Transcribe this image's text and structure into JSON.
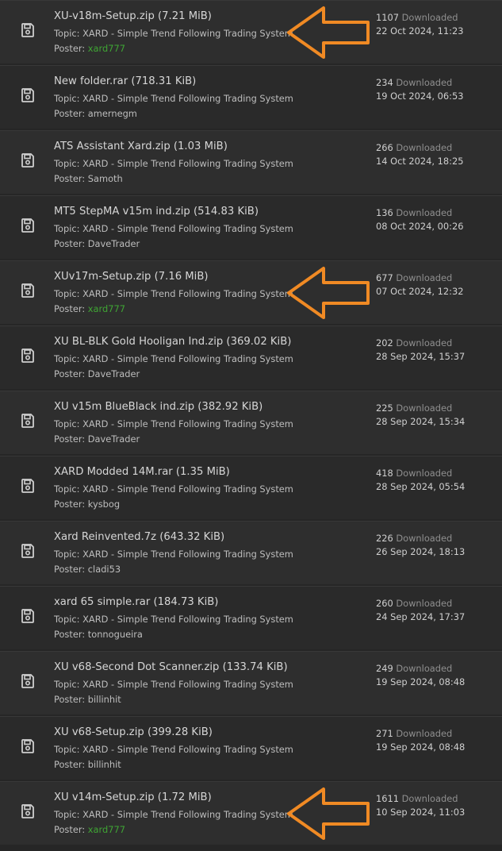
{
  "colors": {
    "background": "#262626",
    "row_background": "#2d2d2d",
    "text": "#d6d6d6",
    "muted": "#8f8f8f",
    "poster_highlight": "#3fa534",
    "annotation_arrow": "#f08a24"
  },
  "labels": {
    "topic_prefix": "Topic: ",
    "poster_prefix": "Poster: ",
    "downloaded": "Downloaded"
  },
  "attachments": [
    {
      "title": "XU-v18m-Setup.zip (7.21 MiB)",
      "topic": "XARD - Simple Trend Following Trading System",
      "poster": "xard777",
      "poster_highlight": true,
      "downloads": "1107",
      "date": "22 Oct 2024, 11:23",
      "arrow": true
    },
    {
      "title": "New folder.rar (718.31 KiB)",
      "topic": "XARD - Simple Trend Following Trading System",
      "poster": "amernegm",
      "poster_highlight": false,
      "downloads": "234",
      "date": "19 Oct 2024, 06:53",
      "arrow": false
    },
    {
      "title": "ATS Assistant Xard.zip (1.03 MiB)",
      "topic": "XARD - Simple Trend Following Trading System",
      "poster": "Samoth",
      "poster_highlight": false,
      "downloads": "266",
      "date": "14 Oct 2024, 18:25",
      "arrow": false
    },
    {
      "title": "MT5 StepMA v15m ind.zip (514.83 KiB)",
      "topic": "XARD - Simple Trend Following Trading System",
      "poster": "DaveTrader",
      "poster_highlight": false,
      "downloads": "136",
      "date": "08 Oct 2024, 00:26",
      "arrow": false
    },
    {
      "title": "XUv17m-Setup.zip (7.16 MiB)",
      "topic": "XARD - Simple Trend Following Trading System",
      "poster": "xard777",
      "poster_highlight": true,
      "downloads": "677",
      "date": "07 Oct 2024, 12:32",
      "arrow": true
    },
    {
      "title": "XU BL-BLK Gold Hooligan Ind.zip (369.02 KiB)",
      "topic": "XARD - Simple Trend Following Trading System",
      "poster": "DaveTrader",
      "poster_highlight": false,
      "downloads": "202",
      "date": "28 Sep 2024, 15:37",
      "arrow": false
    },
    {
      "title": "XU v15m BlueBlack ind.zip (382.92 KiB)",
      "topic": "XARD - Simple Trend Following Trading System",
      "poster": "DaveTrader",
      "poster_highlight": false,
      "downloads": "225",
      "date": "28 Sep 2024, 15:34",
      "arrow": false
    },
    {
      "title": "XARD Modded 14M.rar (1.35 MiB)",
      "topic": "XARD - Simple Trend Following Trading System",
      "poster": "kysbog",
      "poster_highlight": false,
      "downloads": "418",
      "date": "28 Sep 2024, 05:54",
      "arrow": false
    },
    {
      "title": "Xard Reinvented.7z (643.32 KiB)",
      "topic": "XARD - Simple Trend Following Trading System",
      "poster": "cladi53",
      "poster_highlight": false,
      "downloads": "226",
      "date": "26 Sep 2024, 18:13",
      "arrow": false
    },
    {
      "title": "xard 65 simple.rar (184.73 KiB)",
      "topic": "XARD - Simple Trend Following Trading System",
      "poster": "tonnogueira",
      "poster_highlight": false,
      "downloads": "260",
      "date": "24 Sep 2024, 17:37",
      "arrow": false
    },
    {
      "title": "XU v68-Second Dot Scanner.zip (133.74 KiB)",
      "topic": "XARD - Simple Trend Following Trading System",
      "poster": "billinhit",
      "poster_highlight": false,
      "downloads": "249",
      "date": "19 Sep 2024, 08:48",
      "arrow": false
    },
    {
      "title": "XU v68-Setup.zip (399.28 KiB)",
      "topic": "XARD - Simple Trend Following Trading System",
      "poster": "billinhit",
      "poster_highlight": false,
      "downloads": "271",
      "date": "19 Sep 2024, 08:48",
      "arrow": false
    },
    {
      "title": "XU v14m-Setup.zip (1.72 MiB)",
      "topic": "XARD - Simple Trend Following Trading System",
      "poster": "xard777",
      "poster_highlight": true,
      "downloads": "1611",
      "date": "10 Sep 2024, 11:03",
      "arrow": true
    }
  ]
}
